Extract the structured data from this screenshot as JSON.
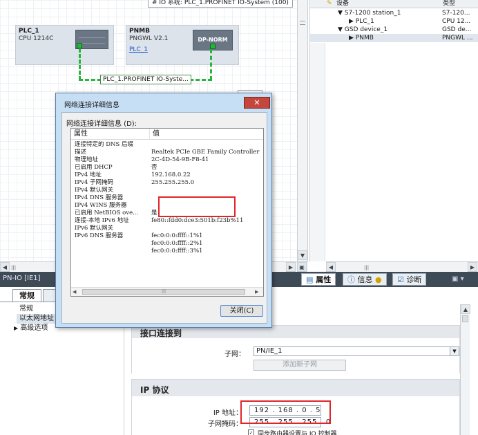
{
  "network_view": {
    "title": "# IO 系统: PLC_1.PROFINET IO-System (100)",
    "plc": {
      "name": "PLC_1",
      "type": "CPU 1214C"
    },
    "pnmb": {
      "name": "PNMB",
      "type": "PNGWL V2.1",
      "link": "PLC_1",
      "module": "DP-NORM"
    },
    "subnet_label": "PLC_1.PROFINET IO-Syste...",
    "ghost_text": "... ..."
  },
  "device_tree": {
    "col_device": "设备",
    "col_type": "类型",
    "rows": [
      {
        "label": "S7-1200 station_1",
        "type": "S7-120...",
        "indent": 1,
        "toggle": "expanded"
      },
      {
        "label": "PLC_1",
        "type": "CPU 12...",
        "indent": 2,
        "toggle": "collapsed"
      },
      {
        "label": "GSD device_1",
        "type": "GSD de...",
        "indent": 1,
        "toggle": "expanded"
      },
      {
        "label": "PNMB",
        "type": "PNGWL ...",
        "indent": 2,
        "toggle": "collapsed"
      }
    ]
  },
  "properties": {
    "title": "PN-IO [IE1]",
    "tabs": {
      "properties": "属性",
      "info": "信息",
      "diagnostics": "诊断"
    },
    "left_tabs": {
      "general": "常规"
    },
    "nav": [
      "常规",
      "以太网地址",
      "高级选项"
    ],
    "section_interface": "接口连接到",
    "subnet_label": "子网：",
    "subnet_value": "PN/IE_1",
    "add_subnet_button": "添加新子网",
    "section_ip": "IP 协议",
    "ip_label": "IP 地址：",
    "ip_value": "192 . 168 . 0   . 5",
    "mask_label": "子网掩码：",
    "mask_value": "255 . 255 . 255 . 0",
    "router_checkbox_label": "同步路由器设置与 IO 控制器"
  },
  "dialog": {
    "title": "网络连接详细信息",
    "caption": "网络连接详细信息 (D):",
    "col_property": "属性",
    "col_value": "值",
    "rows": [
      {
        "k": "连接特定的 DNS 后缀",
        "v": ""
      },
      {
        "k": "描述",
        "v": "Realtek PCIe GBE Family Controller"
      },
      {
        "k": "物理地址",
        "v": "2C-4D-54-9B-F8-41"
      },
      {
        "k": "已启用 DHCP",
        "v": "否"
      },
      {
        "k": "IPv4 地址",
        "v": "192.168.0.22"
      },
      {
        "k": "IPv4 子网掩码",
        "v": "255.255.255.0"
      },
      {
        "k": "IPv4 默认网关",
        "v": ""
      },
      {
        "k": "IPv4 DNS 服务器",
        "v": ""
      },
      {
        "k": "IPv4 WINS 服务器",
        "v": ""
      },
      {
        "k": "已启用 NetBIOS ove...",
        "v": "是"
      },
      {
        "k": "连接-本地 IPv6 地址",
        "v": "fe80::fdd0:dce3:501b:f23b%11"
      },
      {
        "k": "IPv6 默认网关",
        "v": ""
      },
      {
        "k": "IPv6 DNS 服务器",
        "v": "fec0:0:0:ffff::1%1"
      },
      {
        "k": "",
        "v": "fec0:0:0:ffff::2%1"
      },
      {
        "k": "",
        "v": "fec0:0:0:ffff::3%1"
      }
    ],
    "close_button": "关闭(C)",
    "scroll_thumb": "|||"
  }
}
